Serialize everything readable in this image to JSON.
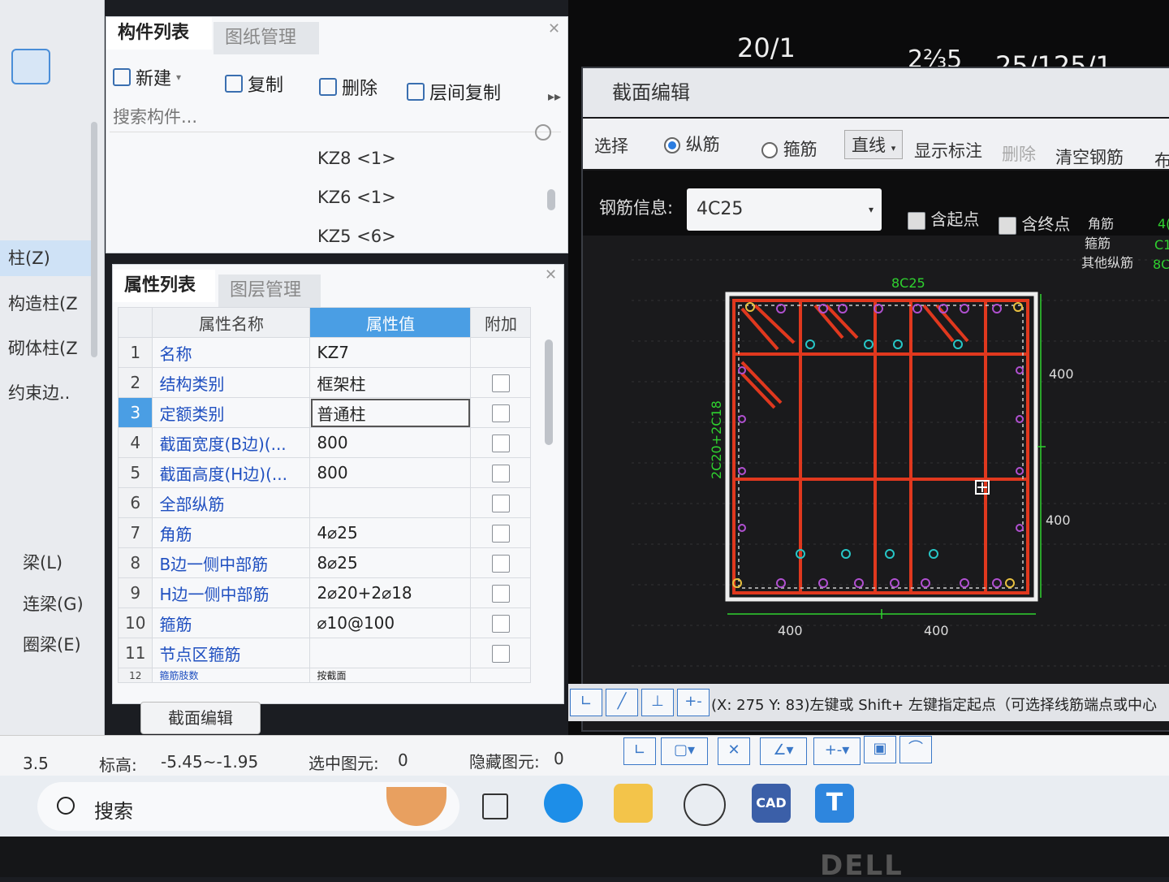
{
  "left_nav": {
    "items": [
      {
        "label": "柱(Z)",
        "active": true
      },
      {
        "label": "构造柱(Z"
      },
      {
        "label": "砌体柱(Z"
      },
      {
        "label": "约束边.."
      },
      {
        "label": "梁(L)"
      },
      {
        "label": "连梁(G)"
      },
      {
        "label": "圈梁(E)"
      }
    ]
  },
  "component_panel": {
    "tabs": [
      "构件列表",
      "图纸管理"
    ],
    "toolbar": {
      "new": "新建",
      "copy": "复制",
      "delete": "删除",
      "floor_copy": "层间复制"
    },
    "search_placeholder": "搜索构件...",
    "items": [
      "KZ8 <1>",
      "KZ6 <1>",
      "KZ5 <6>"
    ]
  },
  "property_panel": {
    "tabs": [
      "属性列表",
      "图层管理"
    ],
    "headers": {
      "name": "属性名称",
      "value": "属性值",
      "extra": "附加"
    },
    "rows": [
      {
        "no": "1",
        "name": "名称",
        "value": "KZ7",
        "checkbox": false
      },
      {
        "no": "2",
        "name": "结构类别",
        "value": "框架柱",
        "checkbox": true
      },
      {
        "no": "3",
        "name": "定额类别",
        "value": "普通柱",
        "checkbox": true
      },
      {
        "no": "4",
        "name": "截面宽度(B边)(...",
        "value": "800",
        "checkbox": true
      },
      {
        "no": "5",
        "name": "截面高度(H边)(...",
        "value": "800",
        "checkbox": true
      },
      {
        "no": "6",
        "name": "全部纵筋",
        "value": "",
        "checkbox": true
      },
      {
        "no": "7",
        "name": "角筋",
        "value": "4⌀25",
        "checkbox": true
      },
      {
        "no": "8",
        "name": "B边一侧中部筋",
        "value": "8⌀25",
        "checkbox": true
      },
      {
        "no": "9",
        "name": "H边一侧中部筋",
        "value": "2⌀20+2⌀18",
        "checkbox": true
      },
      {
        "no": "10",
        "name": "箍筋",
        "value": "⌀10@100",
        "checkbox": true
      },
      {
        "no": "11",
        "name": "节点区箍筋",
        "value": "",
        "checkbox": true
      },
      {
        "no": "12",
        "name": "箍筋肢数",
        "value": "按截面",
        "checkbox": false
      }
    ],
    "selected_row": "3",
    "section_edit_button": "截面编辑"
  },
  "cad_top_labels": [
    "20/1",
    "2⅔5",
    "25/125/1"
  ],
  "section_dialog": {
    "title": "截面编辑",
    "toolbar": {
      "select": "选择",
      "radio_longitudinal": "纵筋",
      "radio_stirrup": "箍筋",
      "line_mode": "直线",
      "show_marks": "显示标注",
      "delete": "删除",
      "clear": "清空钢筋",
      "more": "布"
    },
    "rebar_info_label": "钢筋信息:",
    "rebar_info_value": "4C25",
    "include_start": "含起点",
    "include_end": "含终点",
    "legend": [
      "角筋",
      "箍筋",
      "其他纵筋"
    ],
    "legend_values": [
      "4(",
      "C1",
      "8C"
    ],
    "drawing": {
      "top_label": "8C25",
      "left_label": "2C20+2C18",
      "dims": [
        "400",
        "400",
        "400",
        "400"
      ]
    }
  },
  "command_line": "(X: 275 Y: 83)左键或 Shift+ 左键指定起点（可选择线筋端点或中心",
  "status_bar": {
    "scale": "3.5",
    "elevation_label": "标高:",
    "elevation_value": "-5.45~-1.95",
    "selected_label": "选中图元:",
    "selected_value": "0",
    "hidden_label": "隐藏图元:",
    "hidden_value": "0"
  },
  "taskbar": {
    "search": "搜索",
    "cad_label": "CAD"
  },
  "colors": {
    "accent": "#4a9ee4",
    "rebar": "#e0381e",
    "dim": "#2fd12f",
    "bg_cad": "#0b0b0c"
  }
}
